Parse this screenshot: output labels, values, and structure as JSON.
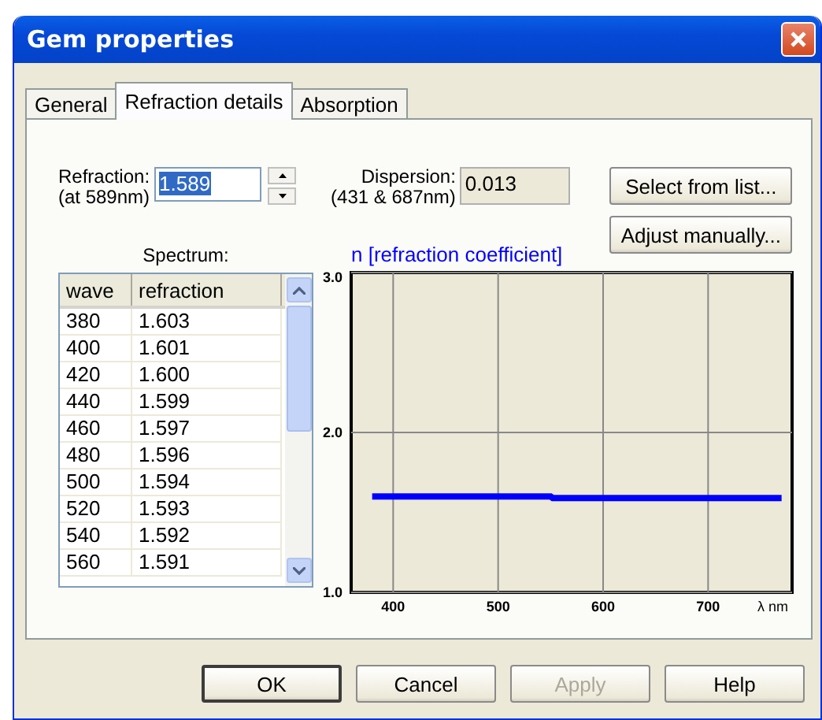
{
  "window": {
    "title": "Gem properties"
  },
  "tabs": [
    {
      "label": "General",
      "selected": false
    },
    {
      "label": "Refraction details",
      "selected": true
    },
    {
      "label": "Absorption",
      "selected": false
    }
  ],
  "refraction": {
    "label_line_1": "Refraction:",
    "label_line_2": "(at 589nm)",
    "value": "1.589"
  },
  "dispersion": {
    "label_line_1": "Dispersion:",
    "label_line_2": "(431 & 687nm)",
    "value": "0.013"
  },
  "side_buttons": [
    "Select from list...",
    "Adjust manually..."
  ],
  "spectrum": {
    "label": "Spectrum:",
    "columns": [
      "wave",
      "refraction"
    ],
    "rows": [
      [
        "380",
        "1.603"
      ],
      [
        "400",
        "1.601"
      ],
      [
        "420",
        "1.600"
      ],
      [
        "440",
        "1.599"
      ],
      [
        "460",
        "1.597"
      ],
      [
        "480",
        "1.596"
      ],
      [
        "500",
        "1.594"
      ],
      [
        "520",
        "1.593"
      ],
      [
        "540",
        "1.592"
      ],
      [
        "560",
        "1.591"
      ]
    ]
  },
  "chart_data": {
    "type": "line",
    "grid": true,
    "title": "n [refraction coefficient]",
    "xlabel": "λ nm",
    "xlim": [
      360,
      780
    ],
    "ylim": [
      1,
      3
    ],
    "xticks": [
      400,
      500,
      600,
      700
    ],
    "yticks": [
      {
        "value": 1,
        "label": "1.0"
      },
      {
        "value": 2,
        "label": "2.0"
      },
      {
        "value": 3,
        "label": "3.0"
      }
    ],
    "x": [
      380,
      550,
      552,
      770
    ],
    "series": [
      {
        "color": "#0000ff",
        "values": [
          1.6,
          1.6,
          1.59,
          1.59
        ]
      }
    ]
  },
  "buttons": [
    {
      "label": "OK",
      "disabled": false,
      "default": true
    },
    {
      "label": "Cancel",
      "disabled": false,
      "default": false
    },
    {
      "label": "Apply",
      "disabled": true,
      "default": false
    },
    {
      "label": "Help",
      "disabled": false,
      "default": false
    }
  ]
}
